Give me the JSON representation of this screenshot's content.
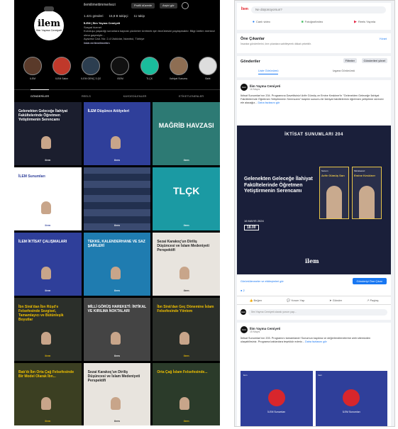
{
  "instagram": {
    "username": "ilemilimeitimmerkezi",
    "follow_label": "Profili düzenle",
    "archive_label": "Arşivi gör",
    "logo_text": "ilem",
    "logo_sub": "İlim Yayma Cemiyeti",
    "stats": {
      "posts": "1.421 gönderi",
      "followers": "15,8 B takipçi",
      "following": "11 takip"
    },
    "bio_name": "İLEM | İlim Yayma Cemiyeti",
    "bio_category": "Sosyal hizmet",
    "bio_text": "Kuruluşu yaşadığı sorunlara kaynak çözümler üretmek için tecrübesini paylaşmaktır. Bilgi üretim merkezi olma gayesiyle...",
    "bio_address": "Ayazma Cad. No: 2-4 Üsküdar, İstanbul, Türkiye",
    "bio_link": "linktr.ee/ilemilimeitim",
    "highlights": [
      "İLEM",
      "İLEM Salon",
      "İLEM GENÇ 3.ŞG",
      "İSEM",
      "TLÇK",
      "İlahiyat Sunumu",
      "Baht"
    ],
    "tabs": [
      "GÖNDERİLER",
      "REELS",
      "KAYDEDİLENLER",
      "ETİKETLENENLER"
    ],
    "posts": [
      {
        "title": "Gelenekten Geleceğe İlahiyat Fakültelerinde Öğretmen Yetiştirmenin Serencamı"
      },
      {
        "title": "İLEM Düşünce Atölyeleri"
      },
      {
        "title": "MAĞRİB HAVZASI"
      },
      {
        "title": "İLEM Sunumları"
      },
      {
        "title": ""
      },
      {
        "title": "TLÇK"
      },
      {
        "title": "İLEM İKTİSAT ÇALIŞMALARI"
      },
      {
        "title": "TEKKE, KALENDERHANE VE SAZ ŞAİRLERİ"
      },
      {
        "title": "Sezai Karakoç'un Diriliş Düşüncesi ve İslam Medeniyeti Perspektifi"
      },
      {
        "title": "İbn Sinâ'dan İbn Rüşd'e Felsefesinde Sezgisel, Tamamlayıcı ve Bütünleşik Boyutlar"
      },
      {
        "title": "MİLLİ GÖRÜŞ HAREKETİ: İNTİKAL VE KIRILMA NOKTALARI"
      },
      {
        "title": "İbn Sinâ'dan Geç Dönemine İslam Felsefesinde Yöntem"
      },
      {
        "title": "Batı'dı İbn Orta Çağ Felsefesinde Bir Model Olarak İbn..."
      },
      {
        "title": "Sezai Karakoç'un Diriliş Düşüncesi ve İslam Medeniyeti Perspektifi"
      },
      {
        "title": "Orta Çağ İslam Felsefesinde..."
      }
    ]
  },
  "facebook": {
    "composer_avatar": "İlem",
    "composer_placeholder": "Ne düşünüyorsun?",
    "composer_actions": [
      "Canlı video",
      "Fotoğraf/video",
      "Reels Yayınla"
    ],
    "featured_title": "Öne Çıkanlar",
    "featured_sub": "İnsanlar gönderilerini, öne çıkanlara sabitleyerek dikkat çekebilir.",
    "featured_link": "Yönet",
    "posts_title": "Gönderiler",
    "filter_label": "Filtreler",
    "manage_label": "Gönderileri yönet",
    "tab_list": "Liste Görünümü",
    "tab_grid": "Izgara Görünümü",
    "post1": {
      "page_name": "İlim Yayma Cemiyeti",
      "date": "16 Mayıs",
      "text": "İktisat Sunumları'nın 204. Programına Davetlisiniz! Arife Gümüş ve Emine Keskiner'in \"Gelenekten Geleceğe İlahiyat Fakültelerinde Öğretmen Yetiştirmenin Serencamı\" başlıklı sunumu ile İlahiyat fakültelerinin öğretmen yetiştirme sürecini ele alacağız...",
      "more": "Daha fazlasını gör",
      "banner_heading": "İKTİSAT SUNUMLARI 204",
      "banner_title": "Gelenekten Geleceğe İlahiyat Fakültelerinde Öğretmen Yetiştirmenin Serencamı",
      "speaker1_label": "Sunum",
      "speaker1_name": "Arife Gümüş Sarı",
      "speaker2_label": "Müzakereci",
      "speaker2_name": "Emine Keskiner",
      "banner_date": "16 MAYIS 2024",
      "banner_time": "18.00",
      "banner_brand": "ilem",
      "insights": "Görüntülenmeler ve etkileşimleri gör",
      "boost": "Gönderiyi Öne Çıkar",
      "reaction_count": "2",
      "actions": [
        "Beğen",
        "Yorum Yap",
        "Gönder",
        "Paylaş"
      ],
      "comment_placeholder": "İlim Yayma Cemiyeti olarak yorum yap..."
    },
    "post2": {
      "page_name": "İlim Yayma Cemiyeti",
      "date": "15 Mayıs",
      "text": "İktisat Sunumları'nın 203. Programını tamamlandı! Sunumun kaydına ve değerlendirmelerine web sitemizden ulaşabilirsiniz. Programa katılanlara teşekkür ederiz...",
      "more": "Daha fazlasını gör",
      "thumb_caption_1": "İLEM Sunumları",
      "thumb_caption_2": "İLEM Sunumları"
    }
  }
}
